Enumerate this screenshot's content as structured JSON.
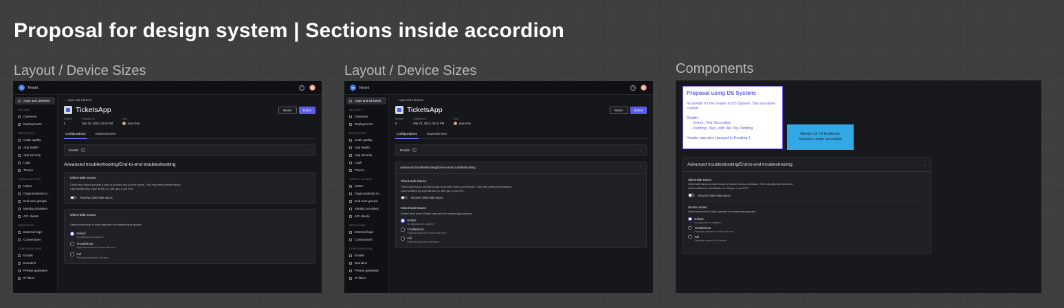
{
  "page": {
    "title": "Proposal for design system |  Sections inside accordion",
    "frame1_label": "Layout / Device Sizes",
    "frame2_label": "Layout / Device Sizes",
    "frame3_label": "Components"
  },
  "topbar": {
    "tenant_logo": "Tx",
    "tenant": "Tenant",
    "help": "?"
  },
  "sidebar": {
    "active": "Apps and Libraries",
    "sections": [
      {
        "label": "DELIVERY",
        "items": [
          "Overview",
          "Deployments"
        ]
      },
      {
        "label": "MONITORING",
        "items": [
          "Code quality",
          "App health",
          "App security",
          "Logs",
          "Traces"
        ]
      },
      {
        "label": "USERS & ACCESS",
        "items": [
          "Users",
          "Organizational ro...",
          "End-user groups",
          "Identity providers",
          "API clients"
        ]
      },
      {
        "label": "RESOURCES",
        "items": [
          "External logic",
          "Connections"
        ]
      },
      {
        "label": "CONFIGURATIONS",
        "items": [
          "Emails",
          "Domains",
          "Private gateways",
          "IP filters"
        ]
      }
    ]
  },
  "main": {
    "breadcrumb": "← Apps and Libraries",
    "app_name": "TicketsApp",
    "button_secondary": "Button",
    "button_primary": "Button",
    "meta": [
      {
        "label": "Revision",
        "value": "5"
      },
      {
        "label": "Published on",
        "value": "Mar 22, 2023, 04:15 PM"
      },
      {
        "label": "User",
        "value": "Jane Doe"
      }
    ],
    "tabs": [
      "Configurations",
      "Dependencies"
    ],
    "emails_label": "Emails",
    "emails_badge": "i",
    "section_title": "Advanced troubleshooting/End-to-end troubleshooting",
    "client_traces_title": "Client-side traces",
    "client_traces_text1": "Client side traces provide a way to monitor end-to-end traces. This may affect performance.",
    "client_traces_text2": "Last modified by Jose Benito on 12th jan, 6 pm EST.",
    "toggle_label": "Receive client-side traces",
    "level_title": "Client-side traces",
    "level_text": "Select trace level of data captured for monitoring purposes",
    "options": [
      {
        "label": "Default",
        "sub": "No payloads are captured"
      },
      {
        "label": "Troubleshoot",
        "sub": "Payloads captured in traces with error"
      },
      {
        "label": "Full",
        "sub": "Payloads captured in all traces"
      }
    ],
    "chevron_down": "⌄",
    "chevron_up": "⌃"
  },
  "frame2": {
    "published_value": "Mar 22, 2023, 08:15 PM",
    "client_traces_text1": "Client side traces provide a way to monitor end-to-end traces. This may affect performance.",
    "client_traces_text2": "Last modified by Jose Benito on 12th jan, 6 pm EST."
  },
  "components": {
    "note_title": "Proposal using DS System:",
    "note_p1": "No divider for the header in DS System. This was done",
    "note_p1b": "custom.",
    "note_divider": "Divider:",
    "note_li1": "- Colour: Text Secondary",
    "note_li2": "- Padding: 16px, with 0px Top Padding",
    "note_p3": "Header was also changed to Heading 3",
    "sticky_line1": "Needs UX UI feedback:",
    "sticky_line2": "Sections under accordion",
    "acc_title": "Advanced troubleshooting/End-to-end troubleshooting",
    "client_title": "Client-side traces",
    "client_text1": "Client side traces provide a way to monitor end-to-end traces. This may affect performance.",
    "client_text2": "Last modified by Jose Benito on 12th jan, 6 pm EST.",
    "toggle_label": "Receive client-side traces",
    "service_title": "Service action",
    "service_text": "Select trace level of data captured for monitoring purposes",
    "options": [
      {
        "label": "Default",
        "sub": "No payloads are captured"
      },
      {
        "label": "Troubleshoot",
        "sub": "Payloads captured in traces with error"
      },
      {
        "label": "Full",
        "sub": "Payloads captured in all traces"
      }
    ]
  },
  "colors": {
    "accent": "#5b5bf0",
    "sticky": "#33a8e6",
    "note_border": "#7b61ff",
    "background": "#3c3c3c"
  }
}
